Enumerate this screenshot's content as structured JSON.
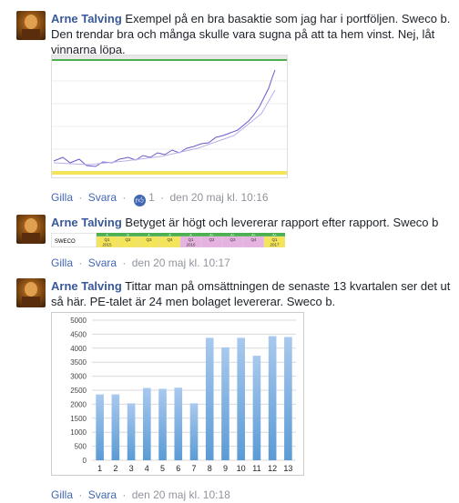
{
  "comments": [
    {
      "author": "Arne Talving",
      "text": "Exempel på en bra basaktie som jag har i portföljen. Sweco b. Den trendar bra och många skulle vara sugna på att ta hem vinst. Nej, låt vinnarna löpa.",
      "like_label": "Gilla",
      "reply_label": "Svara",
      "reaction_count": "1",
      "date": "den 20 maj kl. 10:16"
    },
    {
      "author": "Arne Talving",
      "text": "Betyget är högt och levererar rapport efter rapport. Sweco b",
      "like_label": "Gilla",
      "reply_label": "Svara",
      "date": "den 20 maj kl. 10:17",
      "table": {
        "row_label": "SWECO",
        "quarters": [
          "Q1",
          "Q2",
          "Q3",
          "Q4",
          "Q1",
          "Q2",
          "Q3",
          "Q4",
          "Q1"
        ],
        "grades": [
          "A",
          "B",
          "A",
          "A",
          "A",
          "A+",
          "A+",
          "A+",
          "A+"
        ],
        "years": [
          {
            "label": "2015",
            "color": "#f3e45a"
          },
          {
            "label": "2016",
            "color": "#e6b3e0"
          },
          {
            "label": "2017",
            "color": "#f3e45a"
          }
        ]
      }
    },
    {
      "author": "Arne Talving",
      "text": "Tittar man på omsättningen de senaste 13 kvartalen ser det ut så här. PE-talet är 24 men bolaget levererar. Sweco b.",
      "like_label": "Gilla",
      "reply_label": "Svara",
      "date": "den 20 maj kl. 10:18"
    }
  ],
  "chart_data": {
    "type": "bar",
    "categories": [
      "1",
      "2",
      "3",
      "4",
      "5",
      "6",
      "7",
      "8",
      "9",
      "10",
      "11",
      "12",
      "13"
    ],
    "values": [
      2350,
      2350,
      2030,
      2580,
      2550,
      2590,
      2030,
      4370,
      4030,
      4370,
      3730,
      4430,
      4400
    ],
    "ylim": [
      0,
      5000
    ],
    "yticks": [
      0,
      500,
      1000,
      1500,
      2000,
      2500,
      3000,
      3500,
      4000,
      4500,
      5000
    ],
    "bar_color": "#5b9bd5"
  }
}
